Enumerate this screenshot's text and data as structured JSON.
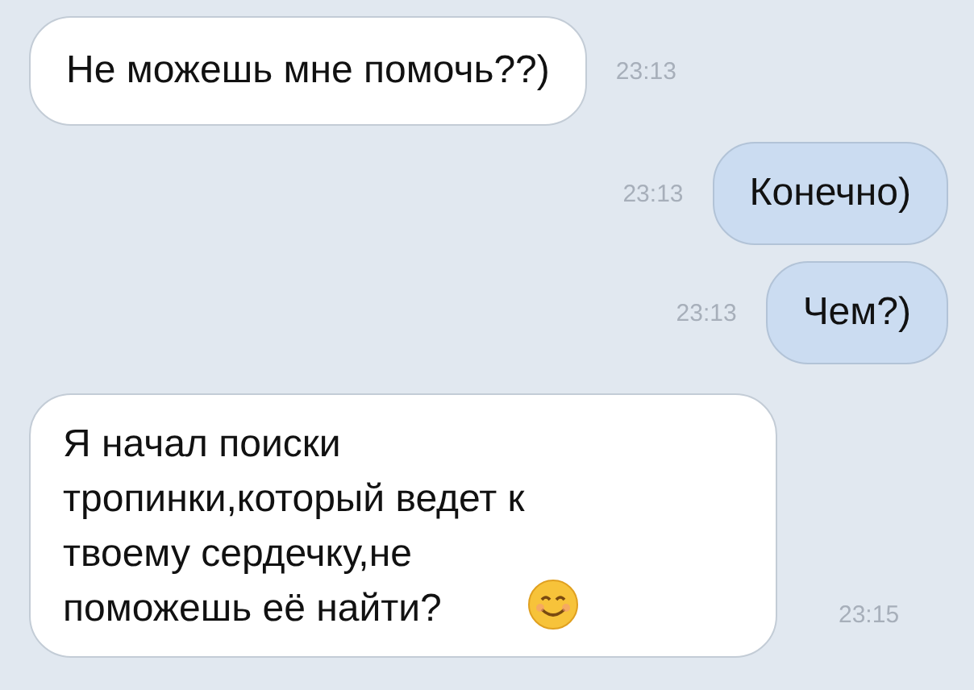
{
  "messages": [
    {
      "kind": "incoming",
      "text": "Не можешь мне помочь??)",
      "time": "23:13"
    },
    {
      "kind": "outgoing",
      "text": "Конечно)",
      "time": "23:13"
    },
    {
      "kind": "outgoing",
      "text": "Чем?)",
      "time": "23:13"
    },
    {
      "kind": "incoming",
      "text": "Я начал поиски\nтропинки,который ведет к\nтвоему сердечку,не\nпоможешь её найти?",
      "time": "23:15",
      "has_emoji": true
    }
  ]
}
